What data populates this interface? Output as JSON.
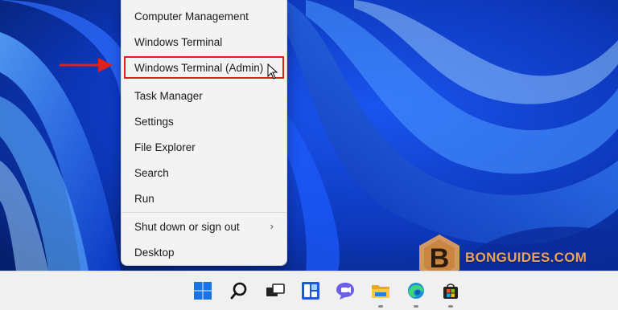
{
  "context_menu": {
    "items": [
      {
        "label": "Computer Management"
      },
      {
        "label": "Windows Terminal"
      },
      {
        "label": "Windows Terminal (Admin)"
      },
      {
        "label": "Task Manager"
      },
      {
        "label": "Settings"
      },
      {
        "label": "File Explorer"
      },
      {
        "label": "Search"
      },
      {
        "label": "Run"
      },
      {
        "label": "Shut down or sign out",
        "chevron": "›"
      },
      {
        "label": "Desktop"
      }
    ]
  },
  "taskbar": {
    "icons": [
      "windows-start-icon",
      "search-icon",
      "task-view-icon",
      "widgets-icon",
      "chat-icon",
      "file-explorer-icon",
      "edge-icon",
      "store-icon"
    ]
  },
  "watermark": {
    "text": "BONGUIDES.COM",
    "letter": "B",
    "color": "#e9a35a"
  },
  "colors": {
    "highlight_border": "#e0201b",
    "arrow": "#e0201b",
    "wallpaper": "#1446d8"
  }
}
